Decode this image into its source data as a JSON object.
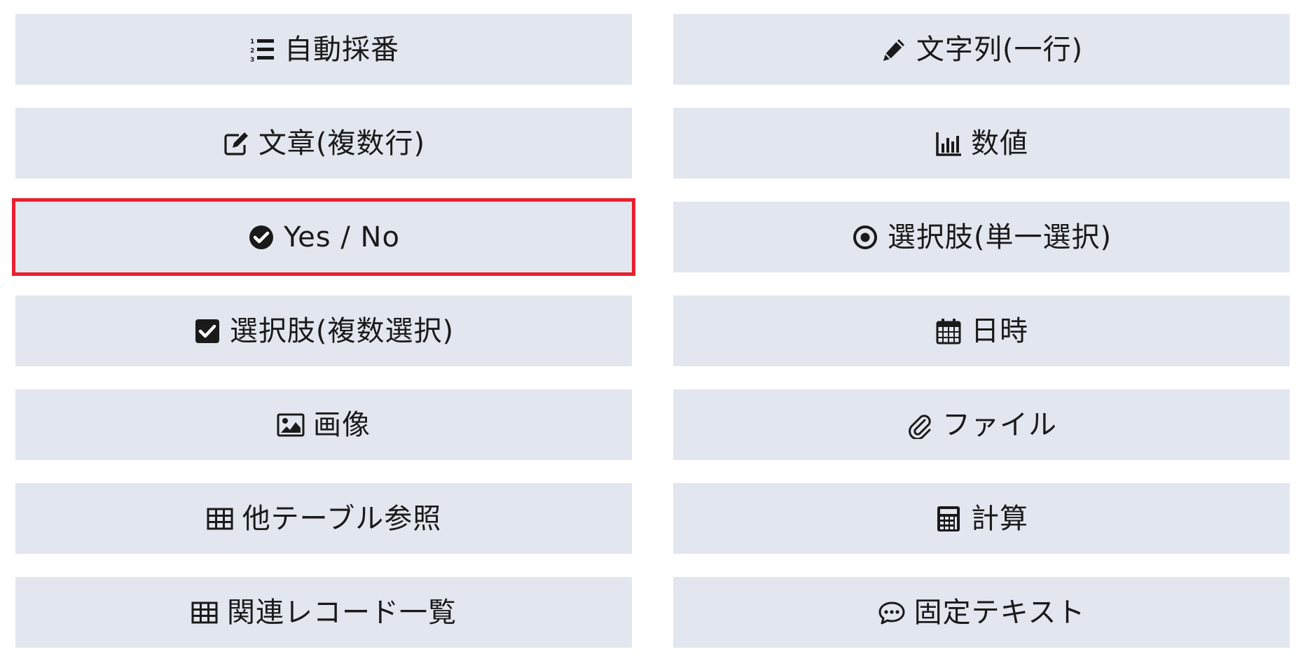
{
  "selected_index": 4,
  "accent_color": "#e8202f",
  "button_bg": "#e2e6ef",
  "buttons": [
    {
      "label": "自動採番",
      "icon": "numbered-list-icon"
    },
    {
      "label": "文字列(一行)",
      "icon": "pencil-icon"
    },
    {
      "label": "文章(複数行)",
      "icon": "edit-square-icon"
    },
    {
      "label": "数値",
      "icon": "bar-chart-icon"
    },
    {
      "label": "Yes / No",
      "icon": "check-circle-icon"
    },
    {
      "label": "選択肢(単一選択)",
      "icon": "radio-dot-icon"
    },
    {
      "label": "選択肢(複数選択)",
      "icon": "check-square-icon"
    },
    {
      "label": "日時",
      "icon": "calendar-icon"
    },
    {
      "label": "画像",
      "icon": "image-icon"
    },
    {
      "label": "ファイル",
      "icon": "paperclip-icon"
    },
    {
      "label": "他テーブル参照",
      "icon": "table-icon"
    },
    {
      "label": "計算",
      "icon": "calculator-icon"
    },
    {
      "label": "関連レコード一覧",
      "icon": "table-icon"
    },
    {
      "label": "固定テキスト",
      "icon": "speech-bubble-icon"
    }
  ]
}
